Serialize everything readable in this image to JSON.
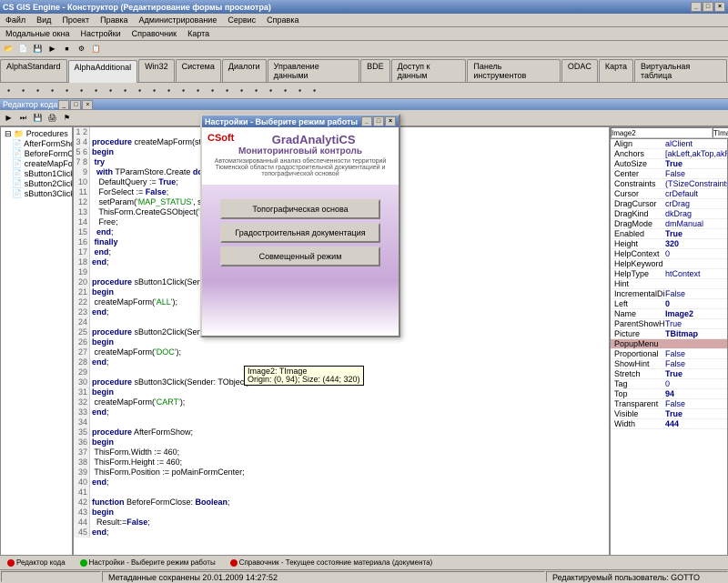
{
  "window": {
    "title": "CS GIS Engine - Конструктор (Редактирование формы просмотра)"
  },
  "menu": [
    "Файл",
    "Вид",
    "Проект",
    "Правка",
    "Администрирование",
    "Сервис",
    "Справка"
  ],
  "menu2": [
    "Модальные окна",
    "Настройки",
    "Справочник",
    "Карта"
  ],
  "tabs": [
    "AlphaStandard",
    "AlphaAdditional",
    "Win32",
    "Система",
    "Диалоги",
    "Управление данными",
    "BDE",
    "Доступ к данным",
    "Панель инструментов",
    "ODAC",
    "Карта",
    "Виртуальная таблица"
  ],
  "editor_panel": "Редактор кода",
  "editor_tabs": [
    "Настройки - Выберите режим работы",
    "Справочник - Текущее состояние материала (документа)"
  ],
  "tree": {
    "root": "Procedures",
    "items": [
      "AfterFormShow",
      "BeforeFormClose",
      "createMapForm",
      "sButton1Click",
      "sButton2Click",
      "sButton3Click"
    ]
  },
  "code_lines": [
    "",
    "procedure createMapForm(status: string);",
    "begin",
    " try",
    "  with TParamStore.Create do begin",
    "   DefaultQuery := True;",
    "   ForSelect := False;",
    "   setParam('MAP_STATUS', status);",
    "   ThisForm.CreateGSObject('MAP');",
    "   Free;",
    "  end;",
    " finally",
    " end;",
    "end;",
    "",
    "procedure sButton1Click(Sender: TObject);",
    "begin",
    " createMapForm('ALL');",
    "end;",
    "",
    "procedure sButton2Click(Sender: TObject);",
    "begin",
    " createMapForm('DOC');",
    "end;",
    "",
    "procedure sButton3Click(Sender: TObject);",
    "begin",
    " createMapForm('CART');",
    "end;",
    "",
    "procedure AfterFormShow;",
    "begin",
    " ThisForm.Width := 460;",
    " ThisForm.Height := 460;",
    " ThisForm.Position := poMainFormCenter;",
    "end;",
    "",
    "function BeforeFormClose: Boolean;",
    "begin",
    "  Result:=False;",
    "end;",
    "",
    "",
    "begin",
    "end;"
  ],
  "props": {
    "object": "Image2",
    "class": "TImage",
    "rows": [
      {
        "n": "Align",
        "v": "alClient"
      },
      {
        "n": "Anchors",
        "v": "[akLeft,akTop,akRight]"
      },
      {
        "n": "AutoSize",
        "v": "True",
        "b": true
      },
      {
        "n": "Center",
        "v": "False"
      },
      {
        "n": "Constraints",
        "v": "(TSizeConstraints)"
      },
      {
        "n": "Cursor",
        "v": "crDefault"
      },
      {
        "n": "DragCursor",
        "v": "crDrag"
      },
      {
        "n": "DragKind",
        "v": "dkDrag"
      },
      {
        "n": "DragMode",
        "v": "dmManual"
      },
      {
        "n": "Enabled",
        "v": "True",
        "b": true
      },
      {
        "n": "Height",
        "v": "320",
        "b": true
      },
      {
        "n": "HelpContext",
        "v": "0"
      },
      {
        "n": "HelpKeyword",
        "v": ""
      },
      {
        "n": "HelpType",
        "v": "htContext"
      },
      {
        "n": "Hint",
        "v": ""
      },
      {
        "n": "IncrementalDisplay",
        "v": "False"
      },
      {
        "n": "Left",
        "v": "0",
        "b": true
      },
      {
        "n": "Name",
        "v": "Image2",
        "b": true
      },
      {
        "n": "ParentShowHint",
        "v": "True"
      },
      {
        "n": "Picture",
        "v": "TBitmap",
        "b": true
      },
      {
        "n": "PopupMenu",
        "v": "",
        "sel": true
      },
      {
        "n": "Proportional",
        "v": "False"
      },
      {
        "n": "ShowHint",
        "v": "False"
      },
      {
        "n": "Stretch",
        "v": "True",
        "b": true
      },
      {
        "n": "Tag",
        "v": "0"
      },
      {
        "n": "Top",
        "v": "94",
        "b": true
      },
      {
        "n": "Transparent",
        "v": "False"
      },
      {
        "n": "Visible",
        "v": "True",
        "b": true
      },
      {
        "n": "Width",
        "v": "444",
        "b": true
      }
    ]
  },
  "dialog": {
    "title": "Настройки - Выберите режим работы",
    "logo": "CSoft",
    "brand": "GradAnalytiCS",
    "subtitle": "Мониторинговый контроль",
    "desc": "Автоматизированный анализ обеспеченности территорий Тюменской области градостроительной документацией и топографической основой",
    "buttons": [
      "Топографическая основа",
      "Градостроительная документация",
      "Совмещенный режим"
    ]
  },
  "tooltip": {
    "l1": "Image2: TImage",
    "l2": "Origin: (0, 94); Size: (444; 320)"
  },
  "bottom_tabs": [
    "Редактор кода",
    "Настройки - Выберите режим работы",
    "Справочник - Текущее состояние материала (документа)"
  ],
  "status": {
    "meta": "Метаданные сохранены 20.01.2009 14:27:52",
    "user": "Редактируемый пользователь: GOTTO"
  }
}
